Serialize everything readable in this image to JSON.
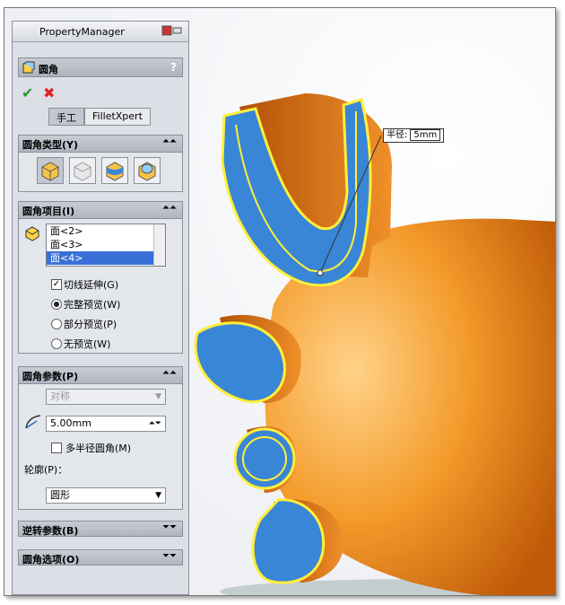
{
  "panel": {
    "title": "PropertyManager",
    "feature_name": "圆角",
    "help": "?",
    "ok": "✔",
    "cancel": "✖",
    "tabs": [
      "手工",
      "FilletXpert"
    ]
  },
  "fillet_type": {
    "label": "圆角类型(Y)",
    "buttons": [
      "constant-radius-icon",
      "variable-radius-icon",
      "face-fillet-icon",
      "full-round-icon"
    ]
  },
  "items": {
    "label": "圆角项目(I)",
    "list": [
      "面<2>",
      "面<3>",
      "面<4>"
    ],
    "selected_index": 2,
    "tangent_label": "切线延伸(G)",
    "tangent_checked": true,
    "preview_options": [
      "完整预览(W)",
      "部分预览(P)",
      "无预览(W)"
    ],
    "preview_selected": 0
  },
  "params": {
    "label": "圆角参数(P)",
    "method": "对称",
    "radius": "5.00mm",
    "multi_radius_label": "多半径圆角(M)",
    "profile_label": "轮廓(P)：",
    "profile_value": "圆形"
  },
  "collapsed": {
    "setback": "逆转参数(B)",
    "options": "圆角选项(O)"
  },
  "callout": {
    "label": "半径:",
    "value": "5mm"
  }
}
